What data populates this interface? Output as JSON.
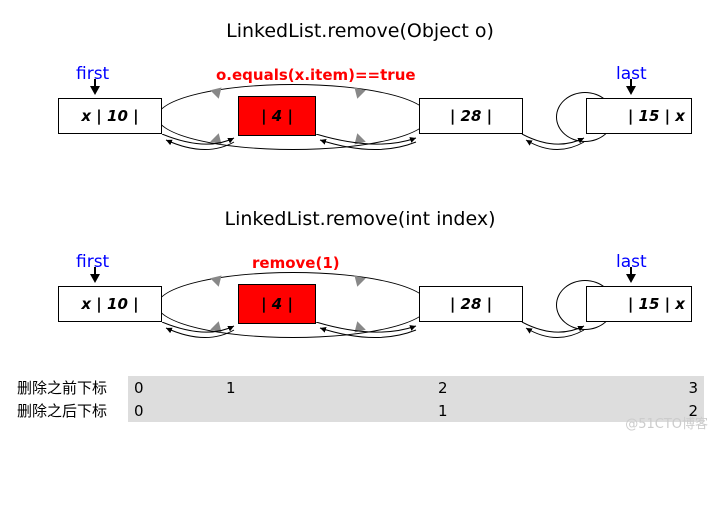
{
  "diagram1": {
    "title": "LinkedList.remove(Object o)",
    "first_label": "first",
    "last_label": "last",
    "caption": "o.equals(x.item)==true",
    "node1": "x | 10 |",
    "node_target": "| 4 |",
    "node3": "| 28 |",
    "node4": "| 15 | x"
  },
  "diagram2": {
    "title": "LinkedList.remove(int index)",
    "first_label": "first",
    "last_label": "last",
    "caption": "remove(1)",
    "node1": "x | 10 |",
    "node_target": "| 4 |",
    "node3": "| 28 |",
    "node4": "| 15 | x"
  },
  "index_rows": {
    "before_label": "删除之前下标",
    "after_label": "删除之后下标",
    "before": [
      "0",
      "1",
      "2",
      "3"
    ],
    "after": [
      "0",
      "",
      "1",
      "2"
    ]
  },
  "watermark": "@51CTO博客",
  "chart_data": {
    "type": "table",
    "title": "Doubly-linked list remove illustration",
    "series": [
      {
        "name": "删除之前下标",
        "values": [
          0,
          1,
          2,
          3
        ]
      },
      {
        "name": "删除之后下标",
        "values": [
          0,
          null,
          1,
          2
        ]
      }
    ],
    "nodes": [
      {
        "value": 10,
        "is_first": true
      },
      {
        "value": 4,
        "removed": true
      },
      {
        "value": 28
      },
      {
        "value": 15,
        "is_last": true
      }
    ]
  }
}
